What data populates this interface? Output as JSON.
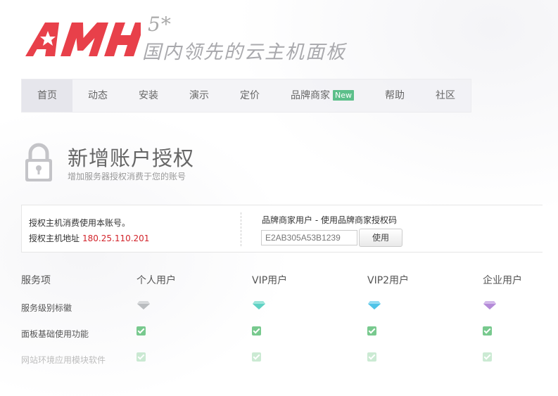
{
  "brand": {
    "logo_text": "AMH",
    "version": "5*",
    "tagline": "国内领先的云主机面板",
    "logo_color": "#e8404a"
  },
  "nav": {
    "items": [
      {
        "label": "首页",
        "active": true
      },
      {
        "label": "动态"
      },
      {
        "label": "安装"
      },
      {
        "label": "演示"
      },
      {
        "label": "定价"
      },
      {
        "label": "品牌商家",
        "badge": "New"
      },
      {
        "label": "帮助"
      },
      {
        "label": "社区"
      }
    ]
  },
  "header": {
    "icon": "lock-icon",
    "title": "新增账户授权",
    "subtitle": "增加服务器授权消费于您的账号"
  },
  "info": {
    "line1": "授权主机消费使用本账号。",
    "host_label": "授权主机地址",
    "host_ip": "180.25.110.201",
    "brand_label": "品牌商家用户 - 使用品牌商家授权码",
    "code_value": "E2AB305A53B1239",
    "use_button": "使用"
  },
  "table": {
    "header": [
      "服务项",
      "个人用户",
      "VIP用户",
      "VIP2用户",
      "企业用户"
    ],
    "rows": [
      {
        "label": "服务级别标徽",
        "type": "diamond",
        "values": [
          "diamond-gray",
          "diamond-teal",
          "diamond-cyan",
          "diamond-purple"
        ]
      },
      {
        "label": "面板基础使用功能",
        "type": "check",
        "values": [
          true,
          true,
          true,
          true
        ]
      },
      {
        "label": "网站环境应用模块软件",
        "type": "check",
        "faded": true,
        "values": [
          true,
          true,
          true,
          true
        ]
      }
    ],
    "colors": {
      "diamond-gray": "#b9bcbf",
      "diamond-teal": "#5fd1c3",
      "diamond-cyan": "#4fc3e8",
      "diamond-purple": "#b48ad8",
      "check": "#78c98e",
      "ip": "#d2232a",
      "badge": "#5cbf8a"
    }
  }
}
